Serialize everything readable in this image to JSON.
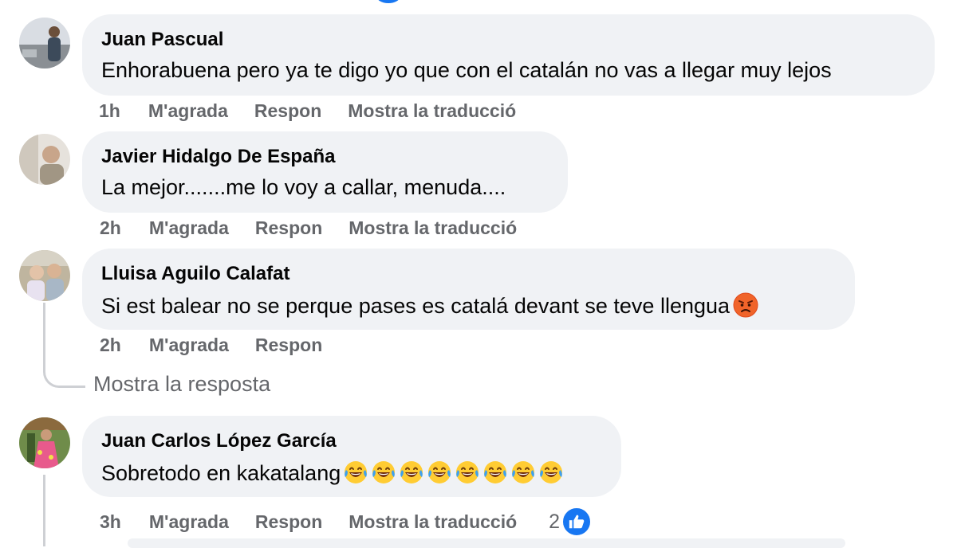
{
  "comments": [
    {
      "author": "Juan Pascual",
      "text": "Enhorabuena pero ya te digo yo que con el catalán no vas a llegar muy lejos",
      "time": "1h",
      "like": "M'agrada",
      "reply": "Respon",
      "translate": "Mostra la traducció"
    },
    {
      "author": "Javier Hidalgo De España",
      "text": "La mejor.......me lo voy a callar, menuda....",
      "time": "2h",
      "like": "M'agrada",
      "reply": "Respon",
      "translate": "Mostra la traducció"
    },
    {
      "author": "Lluisa Aguilo Calafat",
      "text": "Si est balear no se perque pases es catalá devant se teve llengua",
      "emoji": "angry-face-icon",
      "time": "2h",
      "like": "M'agrada",
      "reply": "Respon",
      "show_reply": "Mostra la resposta"
    },
    {
      "author": "Juan Carlos López García",
      "text": "Sobretodo en kakatalang",
      "emoji": "tears-of-joy-icon",
      "emoji_count": 8,
      "time": "3h",
      "like": "M'agrada",
      "reply": "Respon",
      "translate": "Mostra la traducció",
      "reactions": "2",
      "reaction_icon": "thumbs-up-icon"
    }
  ],
  "colors": {
    "bubble": "#f0f2f5",
    "meta_text": "#65676b",
    "accent": "#1877f2"
  }
}
